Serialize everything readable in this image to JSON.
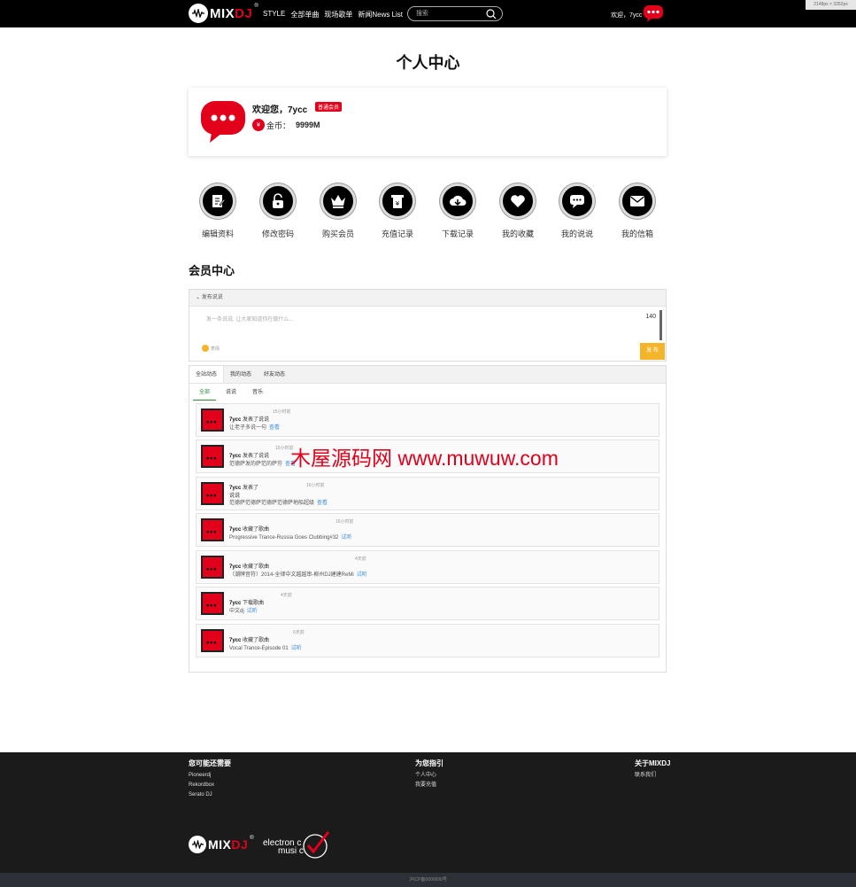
{
  "header": {
    "logo_main": "MIX",
    "logo_accent": "DJ",
    "logo_reg": "®",
    "nav": [
      "STYLE",
      "全部单曲",
      "现场歌单",
      "新闻News List"
    ],
    "search_placeholder": "搜索",
    "greeting": "欢迎，7ycc",
    "size_tag": "2148px × 3352px"
  },
  "page_title": "个人中心",
  "profile": {
    "welcome": "欢迎您，7ycc",
    "badge": "普通会员",
    "coin_label": "金币：",
    "coin_value": "9999M",
    "coin_icon_text": "¥"
  },
  "actions": [
    {
      "label": "编辑资料",
      "icon": "edit-icon"
    },
    {
      "label": "修改密码",
      "icon": "unlock-icon"
    },
    {
      "label": "购买会员",
      "icon": "crown-icon"
    },
    {
      "label": "充值记录",
      "icon": "receipt-icon"
    },
    {
      "label": "下载记录",
      "icon": "cloud-download-icon"
    },
    {
      "label": "我的收藏",
      "icon": "heart-icon"
    },
    {
      "label": "我的说说",
      "icon": "chat-icon"
    },
    {
      "label": "我的信箱",
      "icon": "mail-icon"
    }
  ],
  "section_title": "会员中心",
  "post": {
    "header": "发布说说",
    "placeholder": "发一条说说, 让大家知道你在做什么...",
    "count": "140",
    "emoji_label": "表情",
    "submit": "发 布"
  },
  "feed": {
    "tabs": [
      "全站动态",
      "我的动态",
      "好友动态"
    ],
    "subtabs": [
      "全部",
      "说说",
      "音乐"
    ],
    "items": [
      {
        "user": "7ycc",
        "action": " 发表了说说",
        "time": "15小时前",
        "desc": "让老子多说一句",
        "link": "查看"
      },
      {
        "user": "7ycc",
        "action": " 发表了说说",
        "time": "15小时前",
        "desc": "范德萨发的萨范的萨芬",
        "link": "查看"
      },
      {
        "user": "7ycc",
        "action": " 发表了",
        "action2": "说说",
        "time": "16小时前",
        "desc": "范德萨范德萨范德萨范德萨地船超级",
        "link": "查看"
      },
      {
        "user": "7ycc",
        "action": " 收藏了歌曲",
        "time": "16小时前",
        "desc": "Progressive Trance-Russia Goes Clubbing#32",
        "link": "试听"
      },
      {
        "user": "7ycc",
        "action": " 收藏了歌曲",
        "time": "4天前",
        "desc": "（潮牌音符）2014-全律中文越越串-柳州DJ建建ReMi",
        "link": "试听"
      },
      {
        "user": "7ycc",
        "action": " 下载歌曲",
        "time": "4天前",
        "desc": "中文dj",
        "link": "试听"
      },
      {
        "user": "7ycc",
        "action": " 收藏了歌曲",
        "time": "6天前",
        "desc": "Vocal Trance-Episode 01",
        "link": "试听"
      }
    ]
  },
  "watermark": "木屋源码网 www.muwuw.com",
  "footer": {
    "col1": {
      "title": "您可能还需要",
      "links": [
        "Pioneerdj",
        "Rekordbox",
        "Serato DJ"
      ]
    },
    "col2": {
      "title": "为您指引",
      "links": [
        "个人中心",
        "我要充值"
      ]
    },
    "col3": {
      "title": "关于MIXDJ",
      "links": [
        "联系我们"
      ]
    },
    "partner_line1": "electron c",
    "partner_line2": "musi c",
    "copyright": "沪ICP备0000000号"
  },
  "colors": {
    "brand": "#e3001b",
    "accent": "#f5b52a",
    "link": "#3a8de0"
  }
}
